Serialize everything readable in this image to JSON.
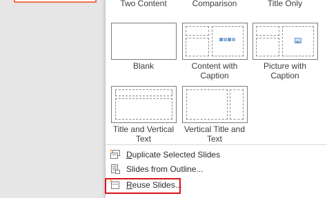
{
  "layouts_top_row": [
    "Two Content",
    "Comparison",
    "Title Only"
  ],
  "layouts": [
    {
      "name": "Blank",
      "label_lines": [
        "Blank"
      ]
    },
    {
      "name": "Content with Caption",
      "label_lines": [
        "Content with",
        "Caption"
      ]
    },
    {
      "name": "Picture with Caption",
      "label_lines": [
        "Picture with",
        "Caption"
      ]
    },
    {
      "name": "Title and Vertical Text",
      "label_lines": [
        "Title and Vertical",
        "Text"
      ]
    },
    {
      "name": "Vertical Title and Text",
      "label_lines": [
        "Vertical Title and",
        "Text"
      ]
    }
  ],
  "menu": [
    {
      "key": "D",
      "rest": "uplicate Selected Slides",
      "icon": "duplicate-slides-icon"
    },
    {
      "key": "",
      "pre": "Slides from Outline...",
      "icon": "outline-icon"
    },
    {
      "key": "R",
      "rest": "euse Slides...",
      "icon": "reuse-slides-icon"
    }
  ],
  "colors": {
    "highlight": "#d6151b",
    "accent_slide_border": "#f36f4a",
    "placeholder_dash": "#8c8c8c",
    "icon_blue": "#2e75b6"
  }
}
